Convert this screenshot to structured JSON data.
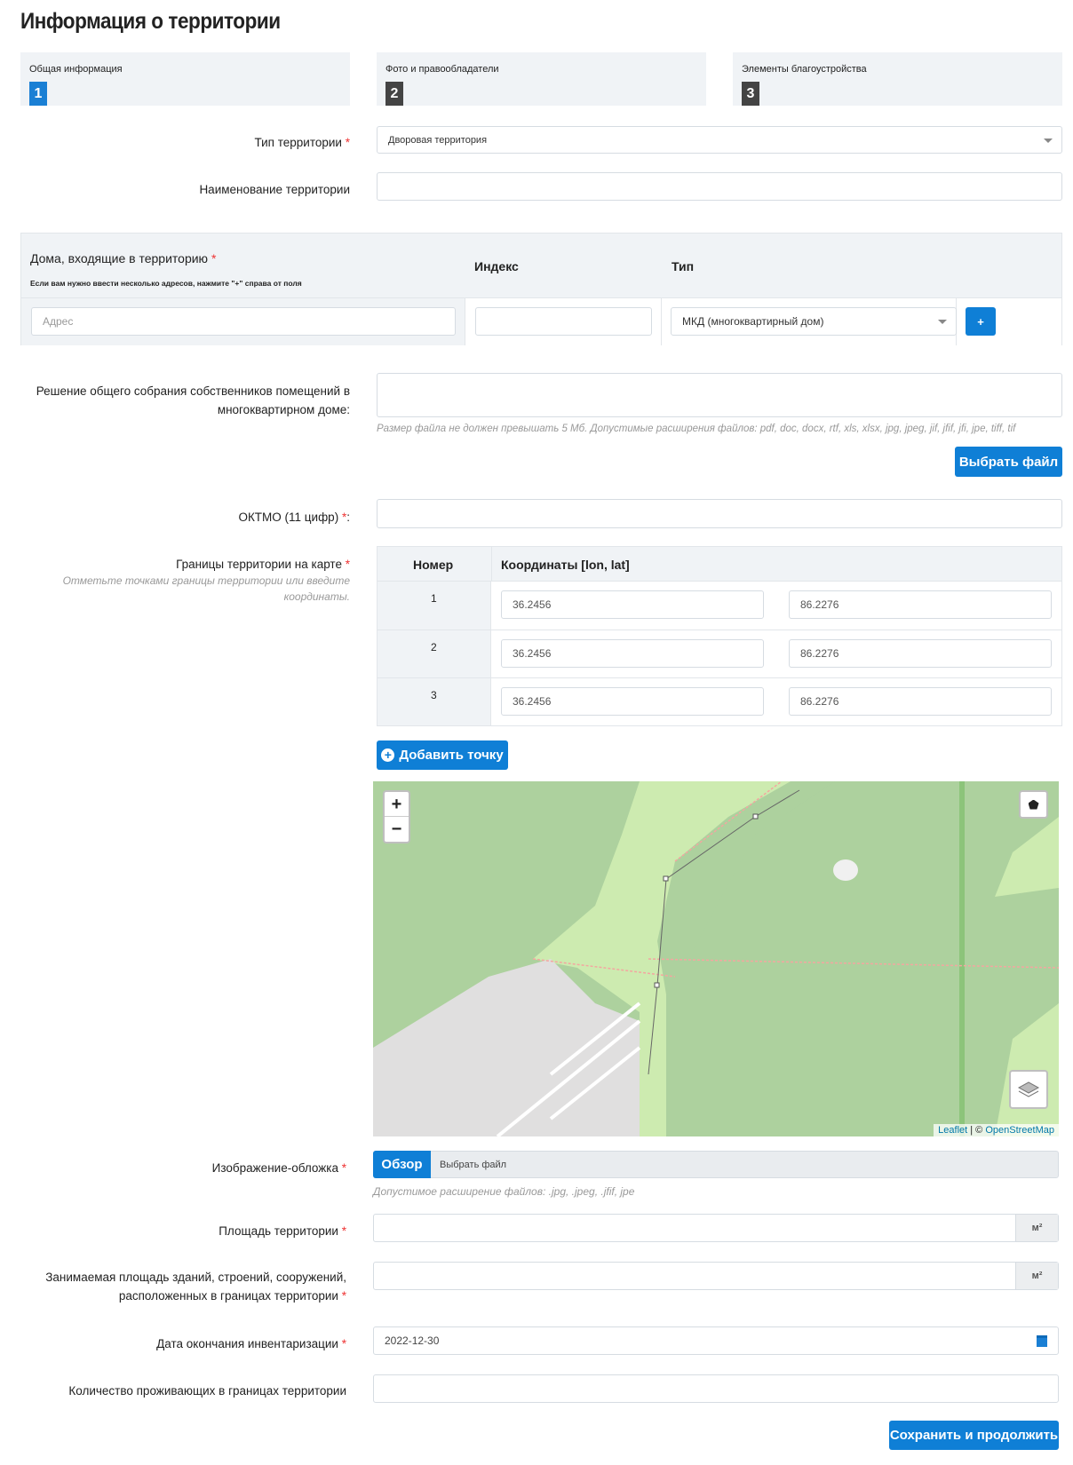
{
  "page_title": "Информация о территории",
  "steps": [
    {
      "label": "Общая информация",
      "num": "1"
    },
    {
      "label": "Фото и правообладатели",
      "num": "2"
    },
    {
      "label": "Элементы благоустройства",
      "num": "3"
    }
  ],
  "territory_type": {
    "label": "Тип территории",
    "value": "Дворовая территория"
  },
  "territory_name": {
    "label": "Наименование территории",
    "value": ""
  },
  "houses": {
    "title": "Дома, входящие в территорию",
    "note": "Если вам нужно ввести несколько адресов, нажмите \"+\" справа от поля",
    "col_index": "Индекс",
    "col_type": "Тип",
    "address_placeholder": "Адрес",
    "type_value": "МКД (многоквартирный дом)",
    "add_label": "+"
  },
  "decision": {
    "label": "Решение общего собрания собственников помещений в многоквартирном доме:",
    "hint": "Размер файла не должен превышать 5 Мб. Допустимые расширения файлов: pdf, doc, docx, rtf, xls, xlsx, jpg, jpeg, jif, jfif, jfi, jpe, tiff, tif",
    "button": "Выбрать файл"
  },
  "oktmo": {
    "label": "ОКТМО (11 цифр)",
    "suffix": ":"
  },
  "bounds": {
    "label": "Границы территории на карте",
    "hint": "Отметьте точками границы территории или введите координаты.",
    "col_num": "Номер",
    "col_coords": "Координаты [lon, lat]",
    "rows": [
      {
        "n": "1",
        "lon": "36.2456",
        "lat": "86.2276"
      },
      {
        "n": "2",
        "lon": "36.2456",
        "lat": "86.2276"
      },
      {
        "n": "3",
        "lon": "36.2456",
        "lat": "86.2276"
      }
    ],
    "add_point": "Добавить точку"
  },
  "map": {
    "zoom_in": "+",
    "zoom_out": "−",
    "attr_leaflet": "Leaflet",
    "attr_sep": " | © ",
    "attr_osm": "OpenStreetMap"
  },
  "cover": {
    "label": "Изображение-обложка",
    "browse": "Обзор",
    "file_text": "Выбрать файл",
    "hint": "Допустимое расширение файлов: .jpg, .jpeg, .jfif, jpe"
  },
  "area": {
    "label": "Площадь территории",
    "unit": "м²"
  },
  "buildings_area": {
    "label1": "Занимаемая площадь зданий, строений, сооружений,",
    "label2": "расположенных в границах территории",
    "unit": "м²"
  },
  "inventory_date": {
    "label": "Дата окончания инвентаризации",
    "value": "2022-12-30"
  },
  "residents": {
    "label": "Количество проживающих в границах территории"
  },
  "save": "Сохранить и продолжить",
  "required_mark": "*"
}
